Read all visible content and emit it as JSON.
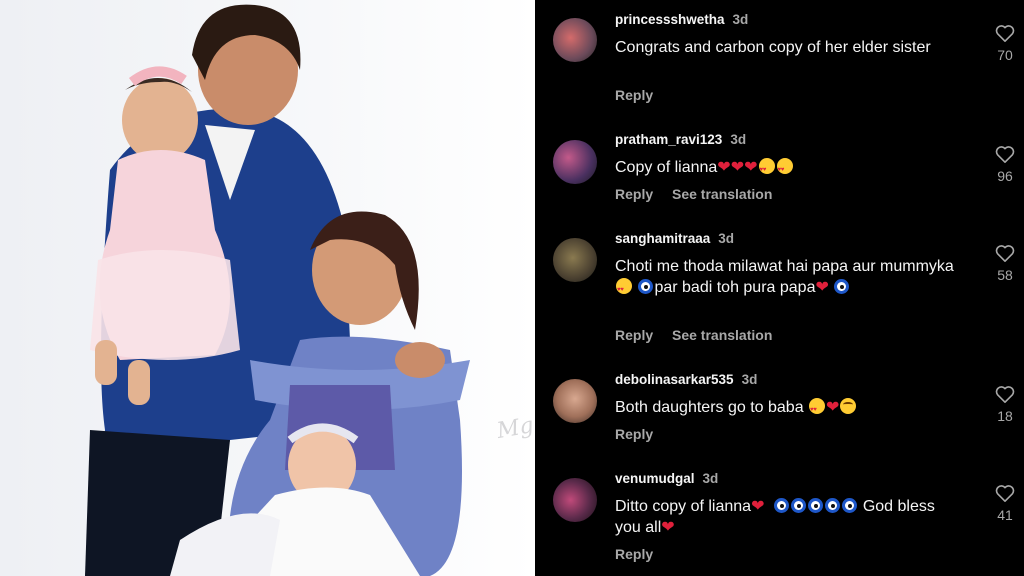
{
  "photo": {
    "watermark": "Mg"
  },
  "comments": [
    {
      "username": "princessshwetha",
      "age": "3d",
      "text": "Congrats and carbon copy of her elder sister",
      "reply": "Reply",
      "likes": "70"
    },
    {
      "username": "pratham_ravi123",
      "age": "3d",
      "text": "Copy of lianna",
      "reply": "Reply",
      "translate": "See translation",
      "likes": "96"
    },
    {
      "username": "sanghamitraaa",
      "age": "3d",
      "text_part1": "Choti me thoda milawat hai papa aur mummyka",
      "text_part2": "par badi toh pura papa",
      "reply": "Reply",
      "translate": "See translation",
      "likes": "58"
    },
    {
      "username": "debolinasarkar535",
      "age": "3d",
      "text": "Both daughters go to baba",
      "reply": "Reply",
      "likes": "18"
    },
    {
      "username": "venumudgal",
      "age": "3d",
      "text_part1": "Ditto copy of lianna",
      "text_part2": "God",
      "text_part3": "bless you all",
      "reply": "Reply",
      "likes": "41"
    }
  ],
  "icons": {
    "like": "heart-outline-icon",
    "heart_emoji": "red-heart-emoji",
    "eye_emoji": "nazar-amulet-emoji",
    "love_emoji": "heart-eyes-emoji",
    "grin_emoji": "grinning-sweat-emoji"
  },
  "colors": {
    "background": "#000000",
    "text": "#f5f5f5",
    "secondary": "#a8a8a8",
    "heart": "#e0203b"
  }
}
